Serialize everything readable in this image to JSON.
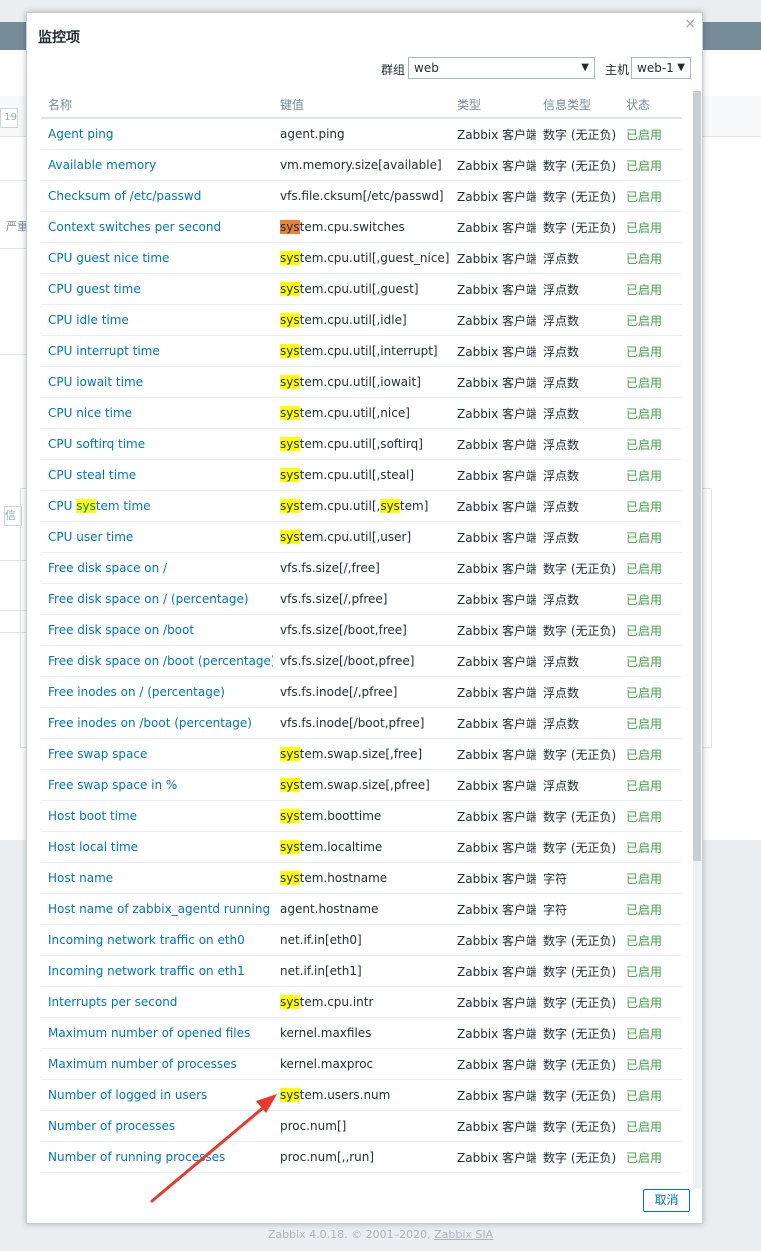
{
  "modal": {
    "title": "监控项",
    "close_icon": "×",
    "cancel_label": "取消"
  },
  "filters": {
    "group_label": "群组",
    "group_value": "web",
    "host_label": "主机",
    "host_value": "web-1"
  },
  "table": {
    "columns": [
      "名称",
      "键值",
      "类型",
      "信息类型",
      "状态"
    ],
    "rows": [
      {
        "name": "Agent ping",
        "key": "agent.ping",
        "type": "Zabbix 客户端",
        "info": "数字 (无正负)",
        "status": "已启用"
      },
      {
        "name": "Available memory",
        "key": "vm.memory.size[available]",
        "type": "Zabbix 客户端",
        "info": "数字 (无正负)",
        "status": "已启用"
      },
      {
        "name": "Checksum of /etc/passwd",
        "key": "vfs.file.cksum[/etc/passwd]",
        "type": "Zabbix 客户端",
        "info": "数字 (无正负)",
        "status": "已启用"
      },
      {
        "name": "Context switches per second",
        "key": "system.cpu.switches",
        "type": "Zabbix 客户端",
        "info": "数字 (无正负)",
        "status": "已启用"
      },
      {
        "name": "CPU guest nice time",
        "key": "system.cpu.util[,guest_nice]",
        "type": "Zabbix 客户端",
        "info": "浮点数",
        "status": "已启用"
      },
      {
        "name": "CPU guest time",
        "key": "system.cpu.util[,guest]",
        "type": "Zabbix 客户端",
        "info": "浮点数",
        "status": "已启用"
      },
      {
        "name": "CPU idle time",
        "key": "system.cpu.util[,idle]",
        "type": "Zabbix 客户端",
        "info": "浮点数",
        "status": "已启用"
      },
      {
        "name": "CPU interrupt time",
        "key": "system.cpu.util[,interrupt]",
        "type": "Zabbix 客户端",
        "info": "浮点数",
        "status": "已启用"
      },
      {
        "name": "CPU iowait time",
        "key": "system.cpu.util[,iowait]",
        "type": "Zabbix 客户端",
        "info": "浮点数",
        "status": "已启用"
      },
      {
        "name": "CPU nice time",
        "key": "system.cpu.util[,nice]",
        "type": "Zabbix 客户端",
        "info": "浮点数",
        "status": "已启用"
      },
      {
        "name": "CPU softirq time",
        "key": "system.cpu.util[,softirq]",
        "type": "Zabbix 客户端",
        "info": "浮点数",
        "status": "已启用"
      },
      {
        "name": "CPU steal time",
        "key": "system.cpu.util[,steal]",
        "type": "Zabbix 客户端",
        "info": "浮点数",
        "status": "已启用"
      },
      {
        "name": "CPU system time",
        "key": "system.cpu.util[,system]",
        "type": "Zabbix 客户端",
        "info": "浮点数",
        "status": "已启用"
      },
      {
        "name": "CPU user time",
        "key": "system.cpu.util[,user]",
        "type": "Zabbix 客户端",
        "info": "浮点数",
        "status": "已启用"
      },
      {
        "name": "Free disk space on /",
        "key": "vfs.fs.size[/,free]",
        "type": "Zabbix 客户端",
        "info": "数字 (无正负)",
        "status": "已启用"
      },
      {
        "name": "Free disk space on / (percentage)",
        "key": "vfs.fs.size[/,pfree]",
        "type": "Zabbix 客户端",
        "info": "浮点数",
        "status": "已启用"
      },
      {
        "name": "Free disk space on /boot",
        "key": "vfs.fs.size[/boot,free]",
        "type": "Zabbix 客户端",
        "info": "数字 (无正负)",
        "status": "已启用"
      },
      {
        "name": "Free disk space on /boot (percentage)",
        "key": "vfs.fs.size[/boot,pfree]",
        "type": "Zabbix 客户端",
        "info": "浮点数",
        "status": "已启用"
      },
      {
        "name": "Free inodes on / (percentage)",
        "key": "vfs.fs.inode[/,pfree]",
        "type": "Zabbix 客户端",
        "info": "浮点数",
        "status": "已启用"
      },
      {
        "name": "Free inodes on /boot (percentage)",
        "key": "vfs.fs.inode[/boot,pfree]",
        "type": "Zabbix 客户端",
        "info": "浮点数",
        "status": "已启用"
      },
      {
        "name": "Free swap space",
        "key": "system.swap.size[,free]",
        "type": "Zabbix 客户端",
        "info": "数字 (无正负)",
        "status": "已启用"
      },
      {
        "name": "Free swap space in %",
        "key": "system.swap.size[,pfree]",
        "type": "Zabbix 客户端",
        "info": "浮点数",
        "status": "已启用"
      },
      {
        "name": "Host boot time",
        "key": "system.boottime",
        "type": "Zabbix 客户端",
        "info": "数字 (无正负)",
        "status": "已启用"
      },
      {
        "name": "Host local time",
        "key": "system.localtime",
        "type": "Zabbix 客户端",
        "info": "数字 (无正负)",
        "status": "已启用"
      },
      {
        "name": "Host name",
        "key": "system.hostname",
        "type": "Zabbix 客户端",
        "info": "字符",
        "status": "已启用"
      },
      {
        "name": "Host name of zabbix_agentd running",
        "key": "agent.hostname",
        "type": "Zabbix 客户端",
        "info": "字符",
        "status": "已启用"
      },
      {
        "name": "Incoming network traffic on eth0",
        "key": "net.if.in[eth0]",
        "type": "Zabbix 客户端",
        "info": "数字 (无正负)",
        "status": "已启用"
      },
      {
        "name": "Incoming network traffic on eth1",
        "key": "net.if.in[eth1]",
        "type": "Zabbix 客户端",
        "info": "数字 (无正负)",
        "status": "已启用"
      },
      {
        "name": "Interrupts per second",
        "key": "system.cpu.intr",
        "type": "Zabbix 客户端",
        "info": "数字 (无正负)",
        "status": "已启用"
      },
      {
        "name": "Maximum number of opened files",
        "key": "kernel.maxfiles",
        "type": "Zabbix 客户端",
        "info": "数字 (无正负)",
        "status": "已启用"
      },
      {
        "name": "Maximum number of processes",
        "key": "kernel.maxproc",
        "type": "Zabbix 客户端",
        "info": "数字 (无正负)",
        "status": "已启用"
      },
      {
        "name": "Number of logged in users",
        "key": "system.users.num",
        "type": "Zabbix 客户端",
        "info": "数字 (无正负)",
        "status": "已启用"
      },
      {
        "name": "Number of processes",
        "key": "proc.num[]",
        "type": "Zabbix 客户端",
        "info": "数字 (无正负)",
        "status": "已启用"
      },
      {
        "name": "Number of running processes",
        "key": "proc.num[,,run]",
        "type": "Zabbix 客户端",
        "info": "数字 (无正负)",
        "status": "已启用"
      }
    ]
  },
  "highlight": {
    "term": "sys",
    "color": "#ffff00",
    "active_color": "#e8823a",
    "arrow_color": "#e8392b"
  },
  "background": {
    "input_value": "19",
    "label_left": "严重",
    "label_left2": "信",
    "footer_text": "Zabbix 4.0.18. © 2001–2020, ",
    "footer_link": "Zabbix SIA"
  }
}
